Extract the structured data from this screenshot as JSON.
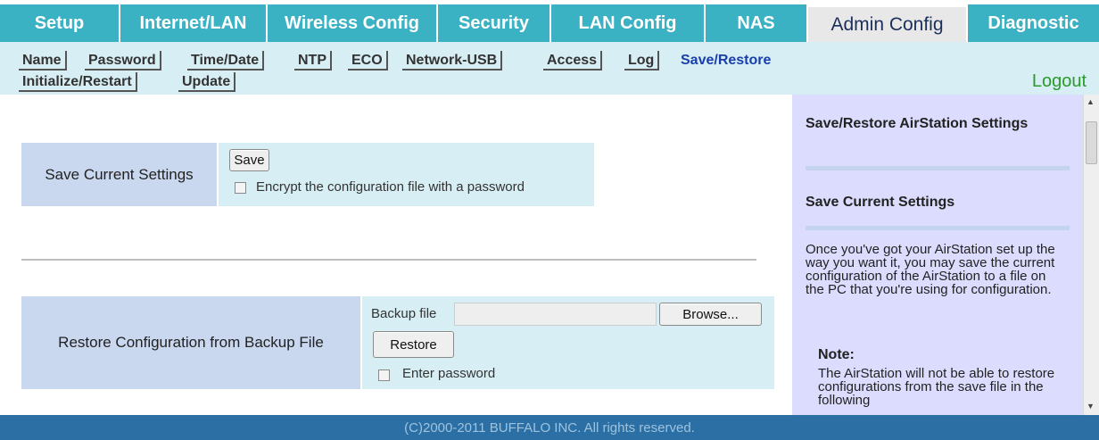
{
  "tabs": [
    {
      "label": "Setup"
    },
    {
      "label": "Internet/LAN"
    },
    {
      "label": "Wireless Config"
    },
    {
      "label": "Security"
    },
    {
      "label": "LAN Config"
    },
    {
      "label": "NAS"
    },
    {
      "label": "Admin Config"
    },
    {
      "label": "Diagnostic"
    }
  ],
  "subnav": {
    "items": [
      "Name",
      "Password",
      "Time/Date",
      "NTP",
      "ECO",
      "Network-USB",
      "Access",
      "Log",
      "Save/Restore",
      "Initialize/Restart",
      "Update"
    ],
    "logout": "Logout"
  },
  "save_section": {
    "label": "Save Current Settings",
    "save_button": "Save",
    "encrypt_label": "Encrypt the configuration file with a password"
  },
  "restore_section": {
    "label": "Restore Configuration from Backup File",
    "backup_file_label": "Backup file",
    "backup_file_value": "",
    "browse_button": "Browse...",
    "restore_button": "Restore",
    "password_label": "Enter password"
  },
  "help": {
    "title": "Save/Restore AirStation Settings",
    "section_title": "Save Current Settings",
    "body": "Once you've got your AirStation set up the way you want it, you may save the current configuration of the AirStation to a file on the PC that you're using for configuration.",
    "note_title": "Note:",
    "note_body": "The AirStation will not be able to restore configurations from the save file in the following"
  },
  "footer": {
    "copyright": "(C)2000-2011 BUFFALO INC. All rights reserved."
  },
  "colors": {
    "tab": "#3bb1c4",
    "active_tab": "#e8e8e8",
    "subnav": "#d6eef4",
    "label_cell": "#c9d7ef",
    "help_panel": "#dcdcff",
    "footer": "#2b6fa5",
    "logout": "#2a9a2a"
  }
}
